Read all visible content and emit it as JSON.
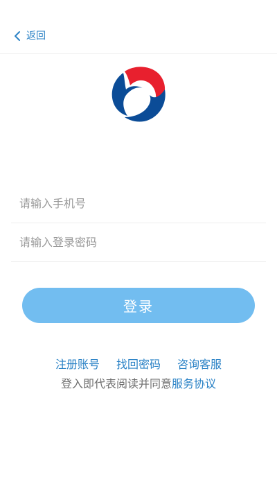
{
  "header": {
    "back_label": "返回"
  },
  "form": {
    "phone_placeholder": "请输入手机号",
    "password_placeholder": "请输入登录密码",
    "login_label": "登录"
  },
  "links": {
    "register": "注册账号",
    "forgot_password": "找回密码",
    "support": "咨询客服"
  },
  "agreement": {
    "prefix": "登入即代表阅读并同意",
    "terms_link": "服务协议"
  },
  "colors": {
    "accent": "#2a82c6",
    "button": "#72bdf0",
    "logo_red": "#e8202e",
    "logo_blue": "#0b4c97"
  },
  "icons": {
    "back": "chevron-left-icon",
    "logo": "brand-logo"
  }
}
